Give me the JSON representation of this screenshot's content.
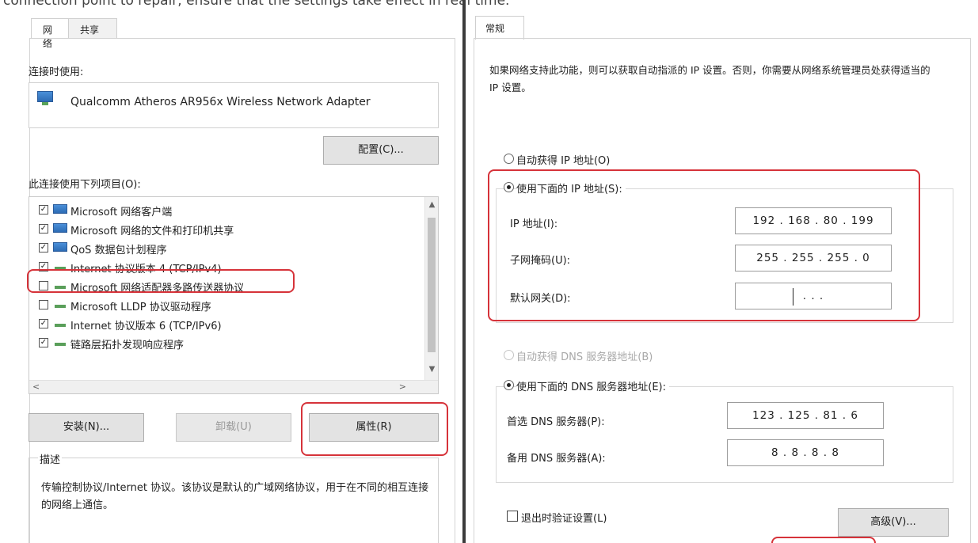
{
  "caption": "connection point to repair, ensure that the settings take effect in real time.",
  "left": {
    "tabs": [
      "网络",
      "共享"
    ],
    "connect_using_label": "连接时使用:",
    "adapter_name": "Qualcomm Atheros AR956x Wireless Network Adapter",
    "configure_button": "配置(C)...",
    "items_label": "此连接使用下列项目(O):",
    "items": [
      {
        "label": "Microsoft 网络客户端",
        "checked": true,
        "icon": "network-client-icon"
      },
      {
        "label": "Microsoft 网络的文件和打印机共享",
        "checked": true,
        "icon": "network-share-icon"
      },
      {
        "label": "QoS 数据包计划程序",
        "checked": true,
        "icon": "qos-icon"
      },
      {
        "label": "Internet 协议版本 4 (TCP/IPv4)",
        "checked": true,
        "icon": "protocol-icon"
      },
      {
        "label": "Microsoft 网络适配器多路传送器协议",
        "checked": false,
        "icon": "protocol-icon"
      },
      {
        "label": "Microsoft LLDP 协议驱动程序",
        "checked": false,
        "icon": "protocol-icon"
      },
      {
        "label": "Internet 协议版本 6 (TCP/IPv6)",
        "checked": true,
        "icon": "protocol-icon"
      },
      {
        "label": "链路层拓扑发现响应程序",
        "checked": true,
        "icon": "protocol-icon"
      }
    ],
    "install_button": "安装(N)...",
    "uninstall_button": "卸载(U)",
    "properties_button": "属性(R)",
    "description_title": "描述",
    "description_text": "传输控制协议/Internet 协议。该协议是默认的广域网络协议，用于在不同的相互连接的网络上通信。"
  },
  "right": {
    "tab": "常规",
    "intro": "如果网络支持此功能，则可以获取自动指派的 IP 设置。否则，你需要从网络系统管理员处获得适当的 IP 设置。",
    "auto_ip_label": "自动获得 IP 地址(O)",
    "manual_ip_label": "使用下面的 IP 地址(S):",
    "ip_label": "IP 地址(I):",
    "ip_value": "192 . 168 . 80 . 199",
    "mask_label": "子网掩码(U):",
    "mask_value": "255 . 255 . 255 . 0",
    "gateway_label": "默认网关(D):",
    "gateway_value": ".      .      .",
    "auto_dns_label": "自动获得 DNS 服务器地址(B)",
    "manual_dns_label": "使用下面的 DNS 服务器地址(E):",
    "pref_dns_label": "首选 DNS 服务器(P):",
    "pref_dns_value": "123 . 125 . 81 . 6",
    "alt_dns_label": "备用 DNS 服务器(A):",
    "alt_dns_value": "8 . 8 . 8 . 8",
    "validate_label": "退出时验证设置(L)",
    "advanced_button": "高级(V)..."
  },
  "colors": {
    "highlight": "#d6333a",
    "accent": "#2d6cb5"
  }
}
